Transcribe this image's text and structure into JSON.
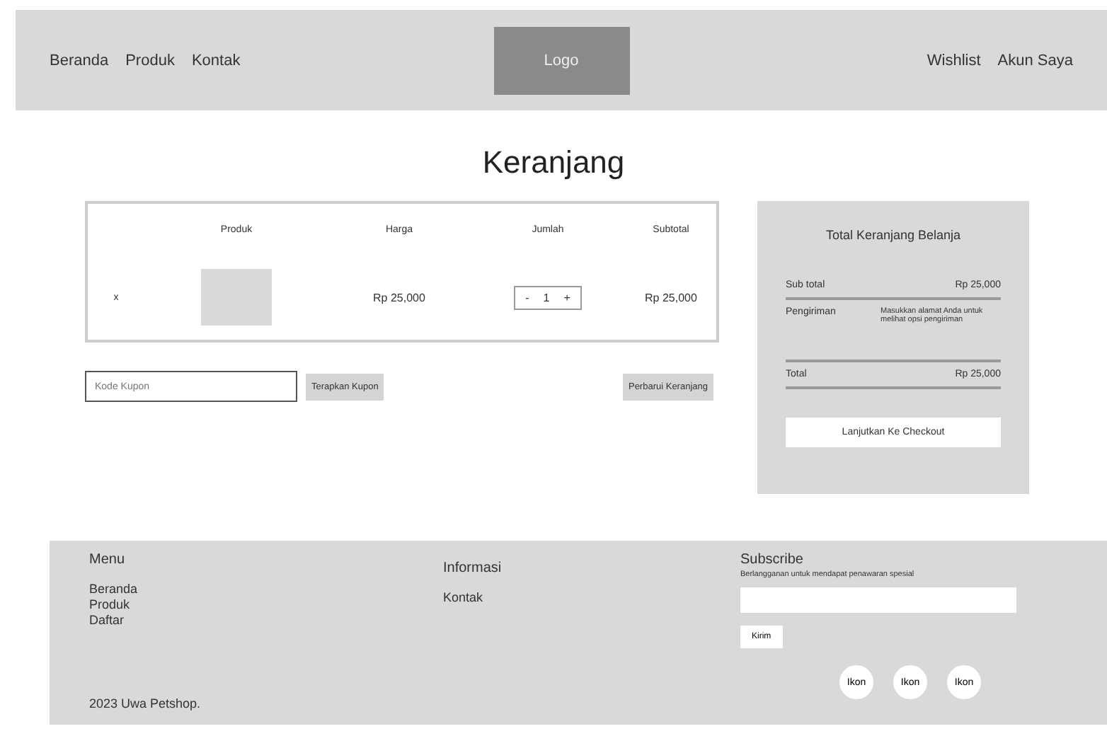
{
  "header": {
    "nav_left": [
      "Beranda",
      "Produk",
      "Kontak"
    ],
    "logo": "Logo",
    "nav_right": [
      "Wishlist",
      "Akun Saya"
    ]
  },
  "page_title": "Keranjang",
  "cart_table": {
    "columns": [
      "Produk",
      "Harga",
      "Jumlah",
      "Subtotal"
    ],
    "rows": [
      {
        "remove": "x",
        "price": "Rp 25,000",
        "quantity": {
          "minus": "-",
          "value": "1",
          "plus": "+"
        },
        "subtotal": "Rp 25,000"
      }
    ]
  },
  "coupon": {
    "placeholder": "Kode Kupon",
    "apply_button": "Terapkan Kupon"
  },
  "update_button": "Perbarui Keranjang",
  "cart_totals": {
    "title": "Total Keranjang Belanja",
    "rows": [
      {
        "label": "Sub total",
        "value": "Rp 25,000"
      },
      {
        "label": "Pengiriman",
        "value": "Masukkan alamat Anda untuk melihat opsi pengiriman"
      },
      {
        "label": "Total",
        "value": "Rp 25,000"
      }
    ],
    "checkout_button": "Lanjutkan Ke Checkout"
  },
  "footer": {
    "menu": {
      "title": "Menu",
      "items": [
        "Beranda",
        "Produk",
        "Daftar"
      ]
    },
    "info": {
      "title": "Informasi",
      "items": [
        "Kontak"
      ]
    },
    "subscribe": {
      "title": "Subscribe",
      "text": "Berlangganan untuk mendapat penawaran spesial",
      "button": "Kirim"
    },
    "social": [
      "Ikon",
      "Ikon",
      "Ikon"
    ],
    "copyright": "2023 Uwa Petshop."
  }
}
